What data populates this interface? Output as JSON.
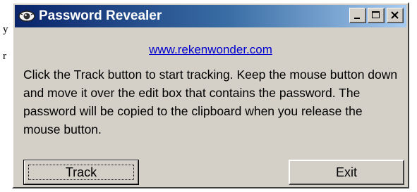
{
  "background": {
    "fragment_top": "y",
    "fragment_mid": "r"
  },
  "window": {
    "title": "Password Revealer",
    "link": "www.rekenwonder.com",
    "description": "Click the Track button to start tracking. Keep the mouse button down and move it over the edit box that contains the password. The password will be copied to the clipboard when you release the mouse button.",
    "buttons": {
      "track": "Track",
      "exit": "Exit"
    },
    "caption_icons": [
      "minimize-icon",
      "maximize-icon",
      "close-icon"
    ],
    "colors": {
      "titlebar_start": "#0a246a",
      "titlebar_end": "#a6caf0",
      "face": "#d4d0c8",
      "link": "#0000cc"
    }
  }
}
